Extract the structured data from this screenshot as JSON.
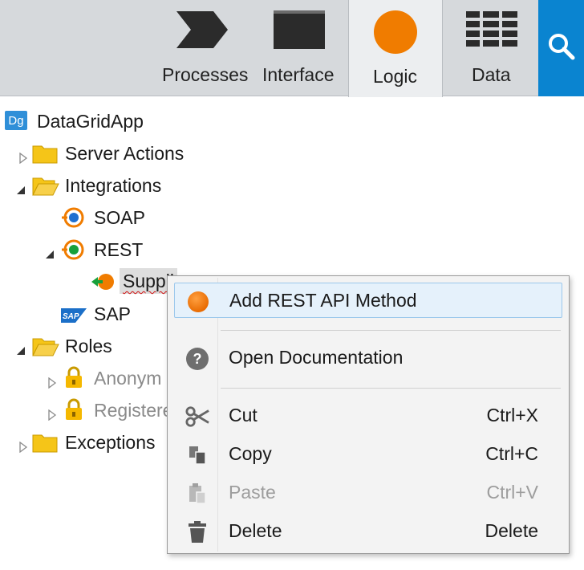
{
  "toolbar": {
    "tabs": [
      {
        "label": "Processes",
        "icon": "processes-chevron-icon",
        "active": false
      },
      {
        "label": "Interface",
        "icon": "interface-window-icon",
        "active": false
      },
      {
        "label": "Logic",
        "icon": "logic-circle-icon",
        "active": true
      },
      {
        "label": "Data",
        "icon": "data-grid-icon",
        "active": false
      }
    ],
    "search_icon": "search-icon"
  },
  "tree": {
    "app_badge": "Dg",
    "app_name": "DataGridApp",
    "nodes": [
      {
        "label": "Server Actions",
        "icon": "folder-icon",
        "expanded": false
      },
      {
        "label": "Integrations",
        "icon": "folder-open-icon",
        "expanded": true
      },
      {
        "label": "SOAP",
        "icon": "soap-icon"
      },
      {
        "label": "REST",
        "icon": "rest-icon",
        "expanded": true
      },
      {
        "label": "Suppli",
        "icon": "rest-consume-icon",
        "selected": true
      },
      {
        "label": "SAP",
        "icon": "sap-logo-icon"
      },
      {
        "label": "Roles",
        "icon": "folder-open-icon",
        "expanded": true
      },
      {
        "label": "Anonym",
        "icon": "lock-icon",
        "expanded": false
      },
      {
        "label": "Registere",
        "icon": "lock-icon",
        "expanded": false
      },
      {
        "label": "Exceptions",
        "icon": "folder-icon",
        "expanded": false
      }
    ]
  },
  "context_menu": {
    "items": [
      {
        "label": "Add REST API Method",
        "shortcut": "",
        "icon": "orange-circle-icon",
        "enabled": true,
        "hovered": true
      },
      {
        "label": "Open Documentation",
        "shortcut": "",
        "icon": "help-icon",
        "enabled": true
      },
      {
        "label": "Cut",
        "shortcut": "Ctrl+X",
        "icon": "scissors-icon",
        "enabled": true
      },
      {
        "label": "Copy",
        "shortcut": "Ctrl+C",
        "icon": "copy-icon",
        "enabled": true
      },
      {
        "label": "Paste",
        "shortcut": "Ctrl+V",
        "icon": "paste-icon",
        "enabled": false
      },
      {
        "label": "Delete",
        "shortcut": "Delete",
        "icon": "trash-icon",
        "enabled": true
      }
    ]
  },
  "colors": {
    "accent_blue": "#0a84d0",
    "logic_orange": "#f07c00",
    "folder_yellow": "#f5c518",
    "menu_hover": "#e5f1fb"
  }
}
